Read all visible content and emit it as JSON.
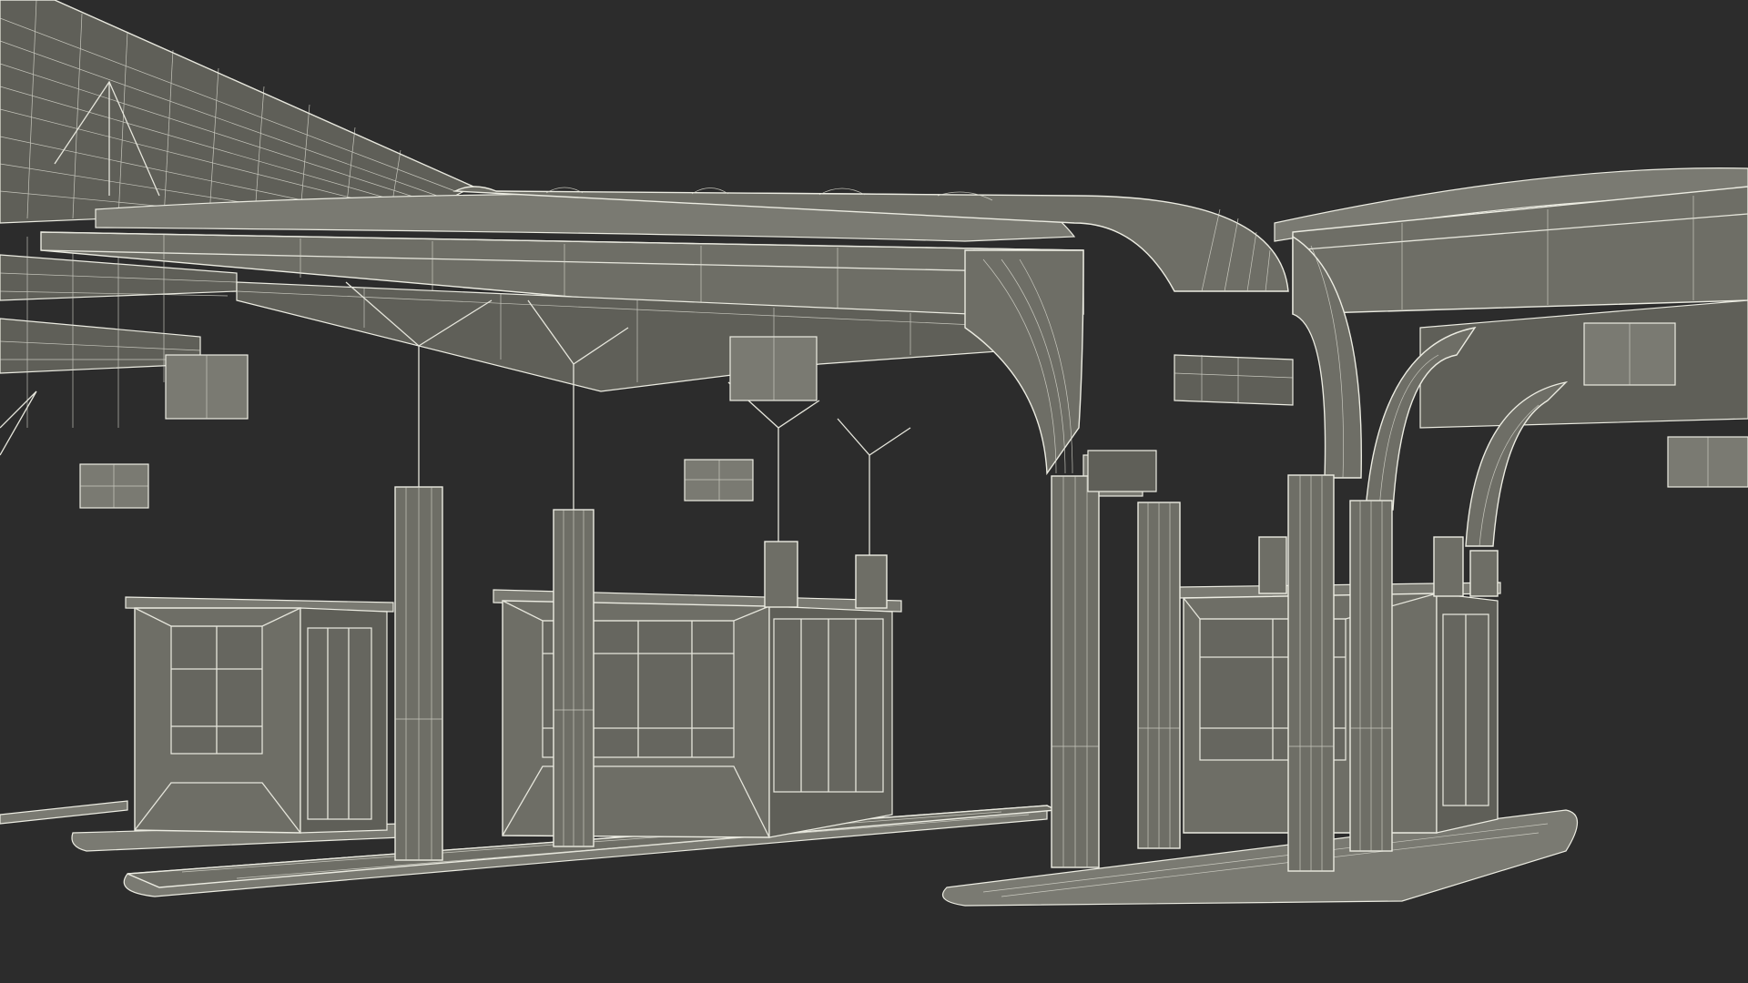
{
  "scene": {
    "subject": "toll-plaza-canopy-wireframe",
    "colors": {
      "background": "#2c2c2c",
      "surface": "#6e6e66",
      "wire": "#e6e6dc"
    }
  }
}
